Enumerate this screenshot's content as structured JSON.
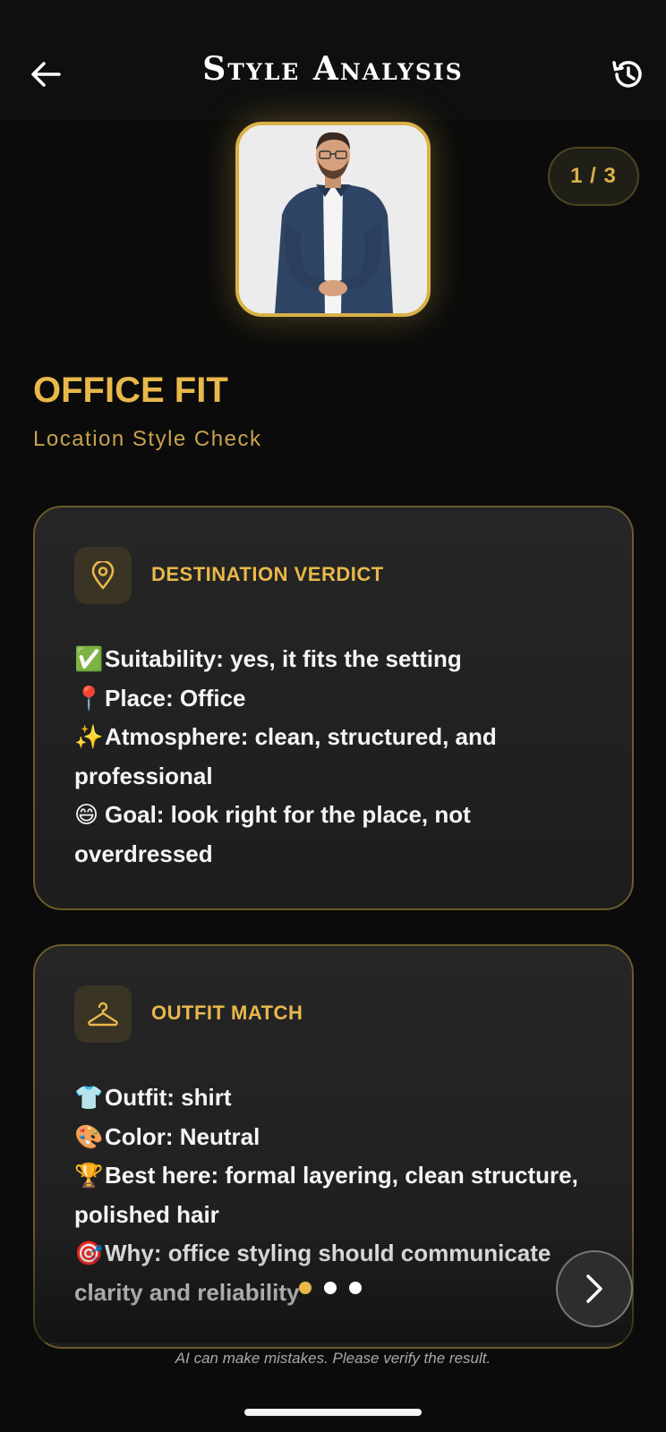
{
  "header": {
    "title": "Style Analysis",
    "back_icon": "arrow-left-icon",
    "history_icon": "history-icon"
  },
  "counter": "1 / 3",
  "section": {
    "title": "OFFICE FIT",
    "subtitle": "Location Style Check"
  },
  "cards": [
    {
      "icon": "location-pin-icon",
      "heading": "DESTINATION VERDICT",
      "lines": [
        {
          "emoji": "✅",
          "text": "Suitability: yes, it fits the setting"
        },
        {
          "emoji": "📍",
          "text": "Place: Office"
        },
        {
          "emoji": "✨",
          "text": "Atmosphere: clean, structured, and professional"
        },
        {
          "emoji": "😄",
          "text": "Goal: look right for the place, not overdressed"
        }
      ]
    },
    {
      "icon": "hanger-icon",
      "heading": "OUTFIT MATCH",
      "lines": [
        {
          "emoji": "👕",
          "text": "Outfit: shirt"
        },
        {
          "emoji": "🎨",
          "text": "Color: Neutral"
        },
        {
          "emoji": "🏆",
          "text": "Best here: formal layering, clean structure, polished hair"
        },
        {
          "emoji": "🎯",
          "text": "Why: office styling should communicate clarity and reliability"
        }
      ]
    }
  ],
  "pagination": {
    "active_index": 0,
    "count": 3
  },
  "disclaimer": "AI can make mistakes. Please verify the result.",
  "colors": {
    "accent": "#e8b84a",
    "background": "#0b0b0b",
    "card": "#232323"
  }
}
